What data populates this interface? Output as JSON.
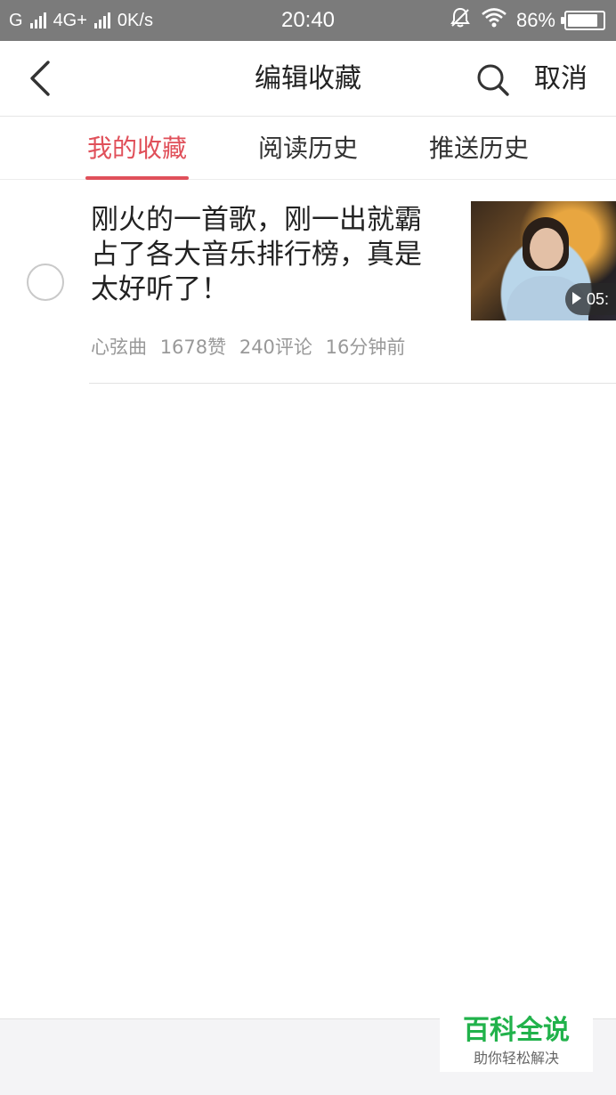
{
  "status_bar": {
    "carrier1": "G",
    "network": "4G+",
    "speed": "0K/s",
    "time": "20:40",
    "battery": "86%",
    "battery_level": 0.86,
    "icons": [
      "signal-icon",
      "mute-alarm-icon",
      "wifi-icon",
      "battery-icon"
    ]
  },
  "header": {
    "title": "编辑收藏",
    "cancel_label": "取消",
    "back_icon": "back-arrow-icon",
    "search_icon": "search-icon"
  },
  "tabs": [
    {
      "label": "我的收藏",
      "active": true
    },
    {
      "label": "阅读历史",
      "active": false
    },
    {
      "label": "推送历史",
      "active": false
    }
  ],
  "items": [
    {
      "title": "刚火的一首歌，刚一出就霸占了各大音乐排行榜，真是太好听了！",
      "source": "心弦曲",
      "likes": "1678赞",
      "comments": "240评论",
      "time": "16分钟前",
      "duration": "05:",
      "selected": false
    }
  ],
  "watermark": {
    "brand": "百科全说",
    "sub": "助你轻松解决"
  },
  "colors": {
    "accent": "#e0505a",
    "status_bar": "#7b7b7b",
    "watermark_brand": "#21b24b"
  }
}
